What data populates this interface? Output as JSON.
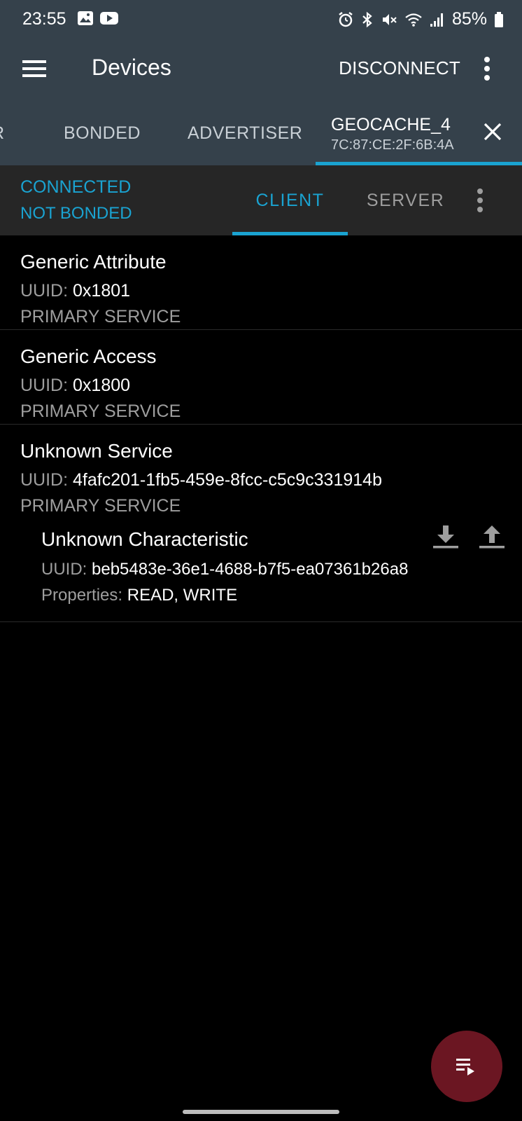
{
  "status_bar": {
    "time": "23:55",
    "battery": "85%"
  },
  "app_bar": {
    "title": "Devices",
    "disconnect_label": "DISCONNECT"
  },
  "device_tabs": {
    "partial_label": "R",
    "items": [
      {
        "label": "BONDED"
      },
      {
        "label": "ADVERTISER"
      }
    ],
    "active": {
      "name": "GEOCACHE_4",
      "address": "7C:87:CE:2F:6B:4A"
    }
  },
  "connection": {
    "state": "CONNECTED",
    "bond_state": "NOT BONDED"
  },
  "sub_tabs": {
    "client": "CLIENT",
    "server": "SERVER",
    "selected": "CLIENT"
  },
  "uuid_label": "UUID:",
  "properties_label": "Properties:",
  "services": [
    {
      "name": "Generic Attribute",
      "uuid": "0x1801",
      "type": "PRIMARY SERVICE"
    },
    {
      "name": "Generic Access",
      "uuid": "0x1800",
      "type": "PRIMARY SERVICE"
    },
    {
      "name": "Unknown Service",
      "uuid": "4fafc201-1fb5-459e-8fcc-c5c9c331914b",
      "type": "PRIMARY SERVICE",
      "characteristic": {
        "name": "Unknown Characteristic",
        "uuid": "beb5483e-36e1-4688-b7f5-ea07361b26a8",
        "properties": "READ, WRITE"
      }
    }
  ],
  "colors": {
    "header_bg": "#35414b",
    "accent": "#1aa3d1",
    "subheader_bg": "#262626",
    "fab_bg": "#6b1622"
  }
}
